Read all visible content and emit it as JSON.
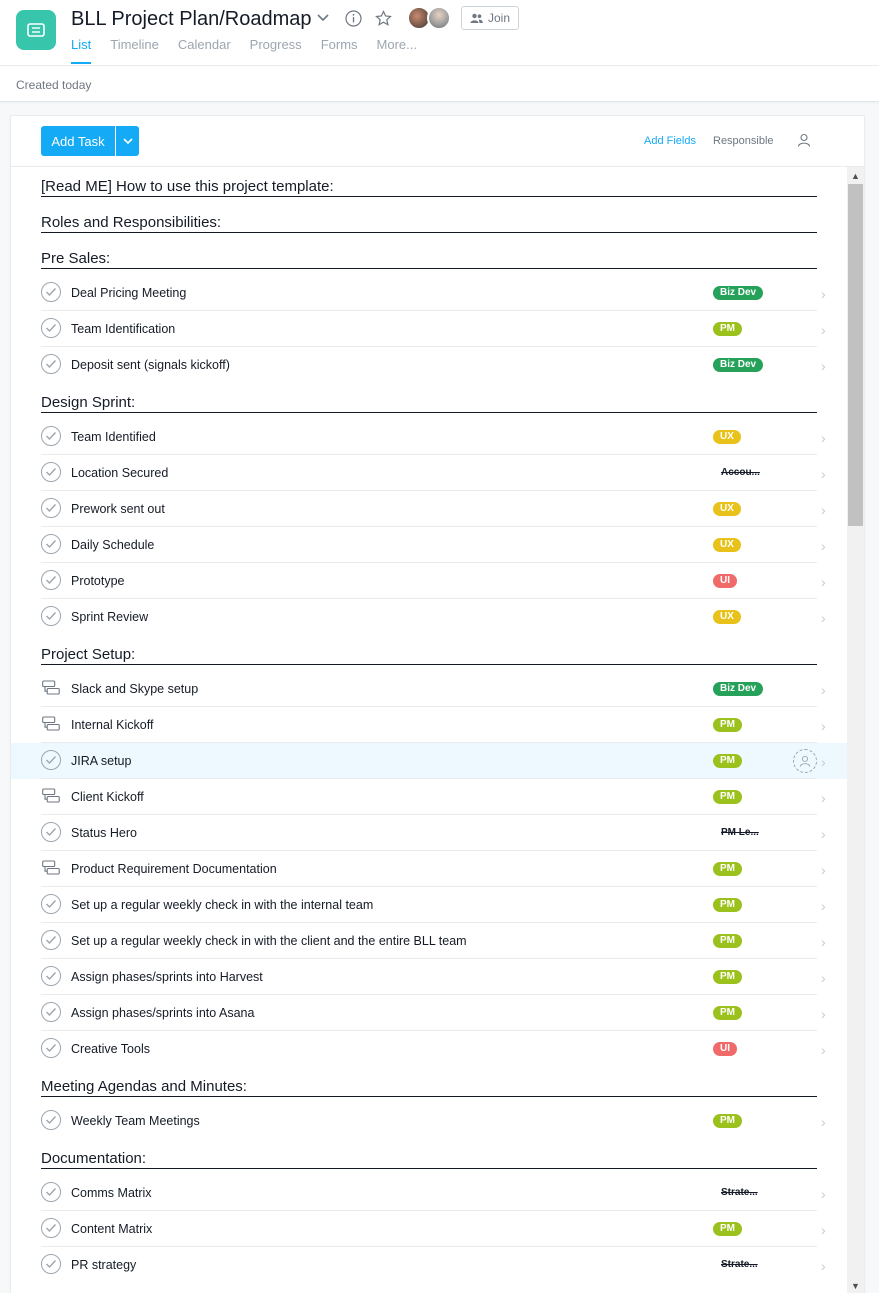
{
  "header": {
    "title": "BLL Project Plan/Roadmap",
    "join_label": "Join",
    "tabs": [
      {
        "label": "List",
        "active": true
      },
      {
        "label": "Timeline"
      },
      {
        "label": "Calendar"
      },
      {
        "label": "Progress"
      },
      {
        "label": "Forms"
      },
      {
        "label": "More..."
      }
    ],
    "icons": [
      "list-icon",
      "chevron-down-icon",
      "info-icon",
      "star-icon",
      "people-icon"
    ]
  },
  "subbar": {
    "created": "Created today"
  },
  "toolbar": {
    "add_task": "Add Task",
    "add_fields": "Add Fields",
    "responsible": "Responsible"
  },
  "colors": {
    "accent": "#14aaf5",
    "project_icon": "#37c5ab",
    "biz_dev": "#25a15a",
    "pm": "#9bc21c",
    "ux": "#e8c21a",
    "ui": "#f06a6a"
  },
  "list": {
    "sections": [
      {
        "title": "[Read ME] How to use this project template:",
        "tasks": []
      },
      {
        "title": "Roles and Responsibilities:",
        "tasks": []
      },
      {
        "title": "Pre Sales:",
        "tasks": [
          {
            "name": "Deal Pricing Meeting",
            "kind": "check",
            "tag": "Biz Dev",
            "tag_style": "bizdev"
          },
          {
            "name": "Team Identification",
            "kind": "check",
            "tag": "PM",
            "tag_style": "pm"
          },
          {
            "name": "Deposit sent (signals kickoff)",
            "kind": "check",
            "tag": "Biz Dev",
            "tag_style": "bizdev"
          }
        ]
      },
      {
        "title": "Design Sprint:",
        "tasks": [
          {
            "name": "Team Identified",
            "kind": "check",
            "tag": "UX",
            "tag_style": "ux"
          },
          {
            "name": "Location Secured",
            "kind": "check",
            "tag": "Accou...",
            "tag_style": "struck"
          },
          {
            "name": "Prework sent out",
            "kind": "check",
            "tag": "UX",
            "tag_style": "ux"
          },
          {
            "name": "Daily Schedule",
            "kind": "check",
            "tag": "UX",
            "tag_style": "ux"
          },
          {
            "name": "Prototype",
            "kind": "check",
            "tag": "UI",
            "tag_style": "ui"
          },
          {
            "name": "Sprint Review",
            "kind": "check",
            "tag": "UX",
            "tag_style": "ux"
          }
        ]
      },
      {
        "title": "Project Setup:",
        "tasks": [
          {
            "name": "Slack and Skype setup",
            "kind": "subtask",
            "tag": "Biz Dev",
            "tag_style": "bizdev"
          },
          {
            "name": "Internal Kickoff",
            "kind": "subtask",
            "tag": "PM",
            "tag_style": "pm"
          },
          {
            "name": "JIRA setup",
            "kind": "check",
            "tag": "PM",
            "tag_style": "pm",
            "highlight": true
          },
          {
            "name": "Client Kickoff",
            "kind": "subtask",
            "tag": "PM",
            "tag_style": "pm"
          },
          {
            "name": "Status Hero",
            "kind": "check",
            "tag": "PM Le...",
            "tag_style": "struck"
          },
          {
            "name": "Product Requirement Documentation",
            "kind": "subtask",
            "tag": "PM",
            "tag_style": "pm"
          },
          {
            "name": "Set up a regular weekly check in with the internal team",
            "kind": "check",
            "tag": "PM",
            "tag_style": "pm"
          },
          {
            "name": "Set up a regular weekly check in with the client and the entire BLL team",
            "kind": "check",
            "tag": "PM",
            "tag_style": "pm"
          },
          {
            "name": "Assign phases/sprints into Harvest",
            "kind": "check",
            "tag": "PM",
            "tag_style": "pm"
          },
          {
            "name": "Assign phases/sprints into Asana",
            "kind": "check",
            "tag": "PM",
            "tag_style": "pm"
          },
          {
            "name": "Creative Tools",
            "kind": "check",
            "tag": "UI",
            "tag_style": "ui"
          }
        ]
      },
      {
        "title": "Meeting Agendas and Minutes:",
        "tasks": [
          {
            "name": "Weekly Team Meetings",
            "kind": "check",
            "tag": "PM",
            "tag_style": "pm"
          }
        ]
      },
      {
        "title": "Documentation:",
        "tasks": [
          {
            "name": "Comms Matrix",
            "kind": "check",
            "tag": "Strate...",
            "tag_style": "struck"
          },
          {
            "name": "Content Matrix",
            "kind": "check",
            "tag": "PM",
            "tag_style": "pm"
          },
          {
            "name": "PR strategy",
            "kind": "check",
            "tag": "Strate...",
            "tag_style": "struck"
          }
        ]
      }
    ]
  }
}
